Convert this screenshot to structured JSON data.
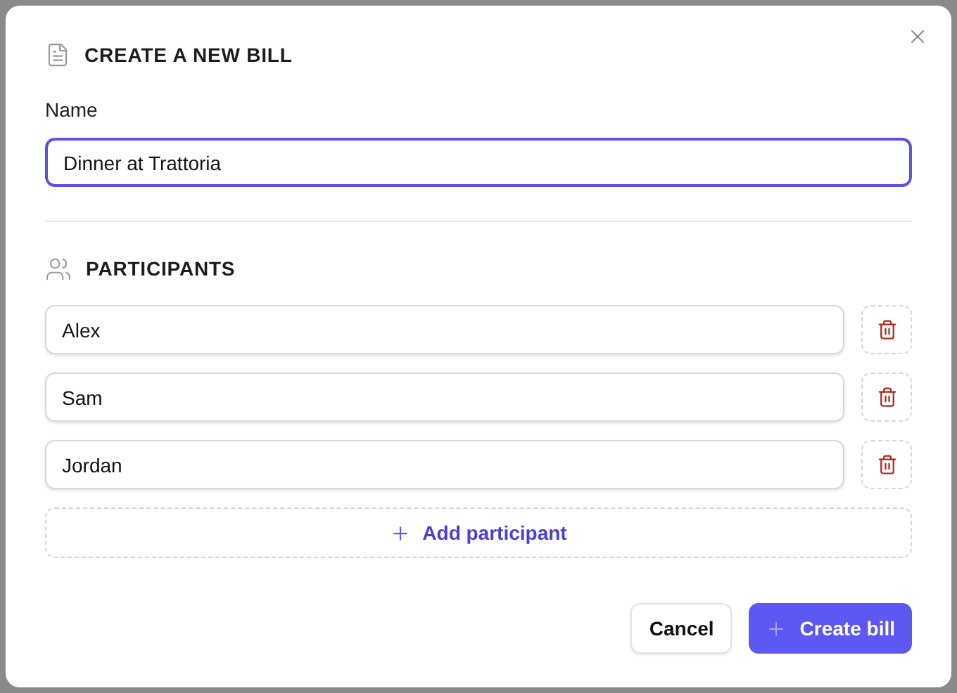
{
  "dialog": {
    "title": "CREATE A NEW BILL"
  },
  "name_field": {
    "label": "Name",
    "value": "Dinner at Trattoria",
    "focused": true
  },
  "participants": {
    "heading": "PARTICIPANTS",
    "items": [
      {
        "value": "Alex"
      },
      {
        "value": "Sam"
      },
      {
        "value": "Jordan"
      }
    ],
    "add_label": "Add participant"
  },
  "buttons": {
    "cancel": "Cancel",
    "create": "Create bill"
  }
}
